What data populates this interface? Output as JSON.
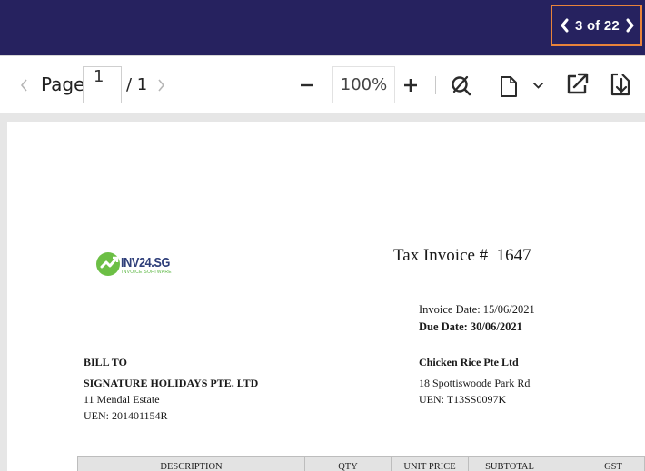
{
  "viewer": {
    "counter": "3 of 22",
    "page_label": "Page",
    "page_value": "1",
    "page_total": "/ 1",
    "zoom_value": "100%"
  },
  "invoice": {
    "title": "Tax Invoice #  1647",
    "logo_text": "INV24.SG",
    "logo_subtext": "INVOICE SOFTWARE",
    "invoice_date": "Invoice Date: 15/06/2021",
    "due_date": "Due Date: 30/06/2021",
    "bill_to_label": "BILL TO",
    "customer": {
      "name": "SIGNATURE HOLIDAYS PTE. LTD",
      "address": "11 Mendal Estate",
      "uen": "UEN: 201401154R"
    },
    "company": {
      "name": "Chicken Rice Pte Ltd",
      "address": "18 Spottiswoode Park Rd",
      "uen": "UEN: T13SS0097K"
    },
    "table_headers": [
      "DESCRIPTION",
      "QTY",
      "UNIT PRICE",
      "SUBTOTAL",
      "GST"
    ]
  },
  "colors": {
    "topbar": "#26225f",
    "highlight": "#e8833a"
  }
}
